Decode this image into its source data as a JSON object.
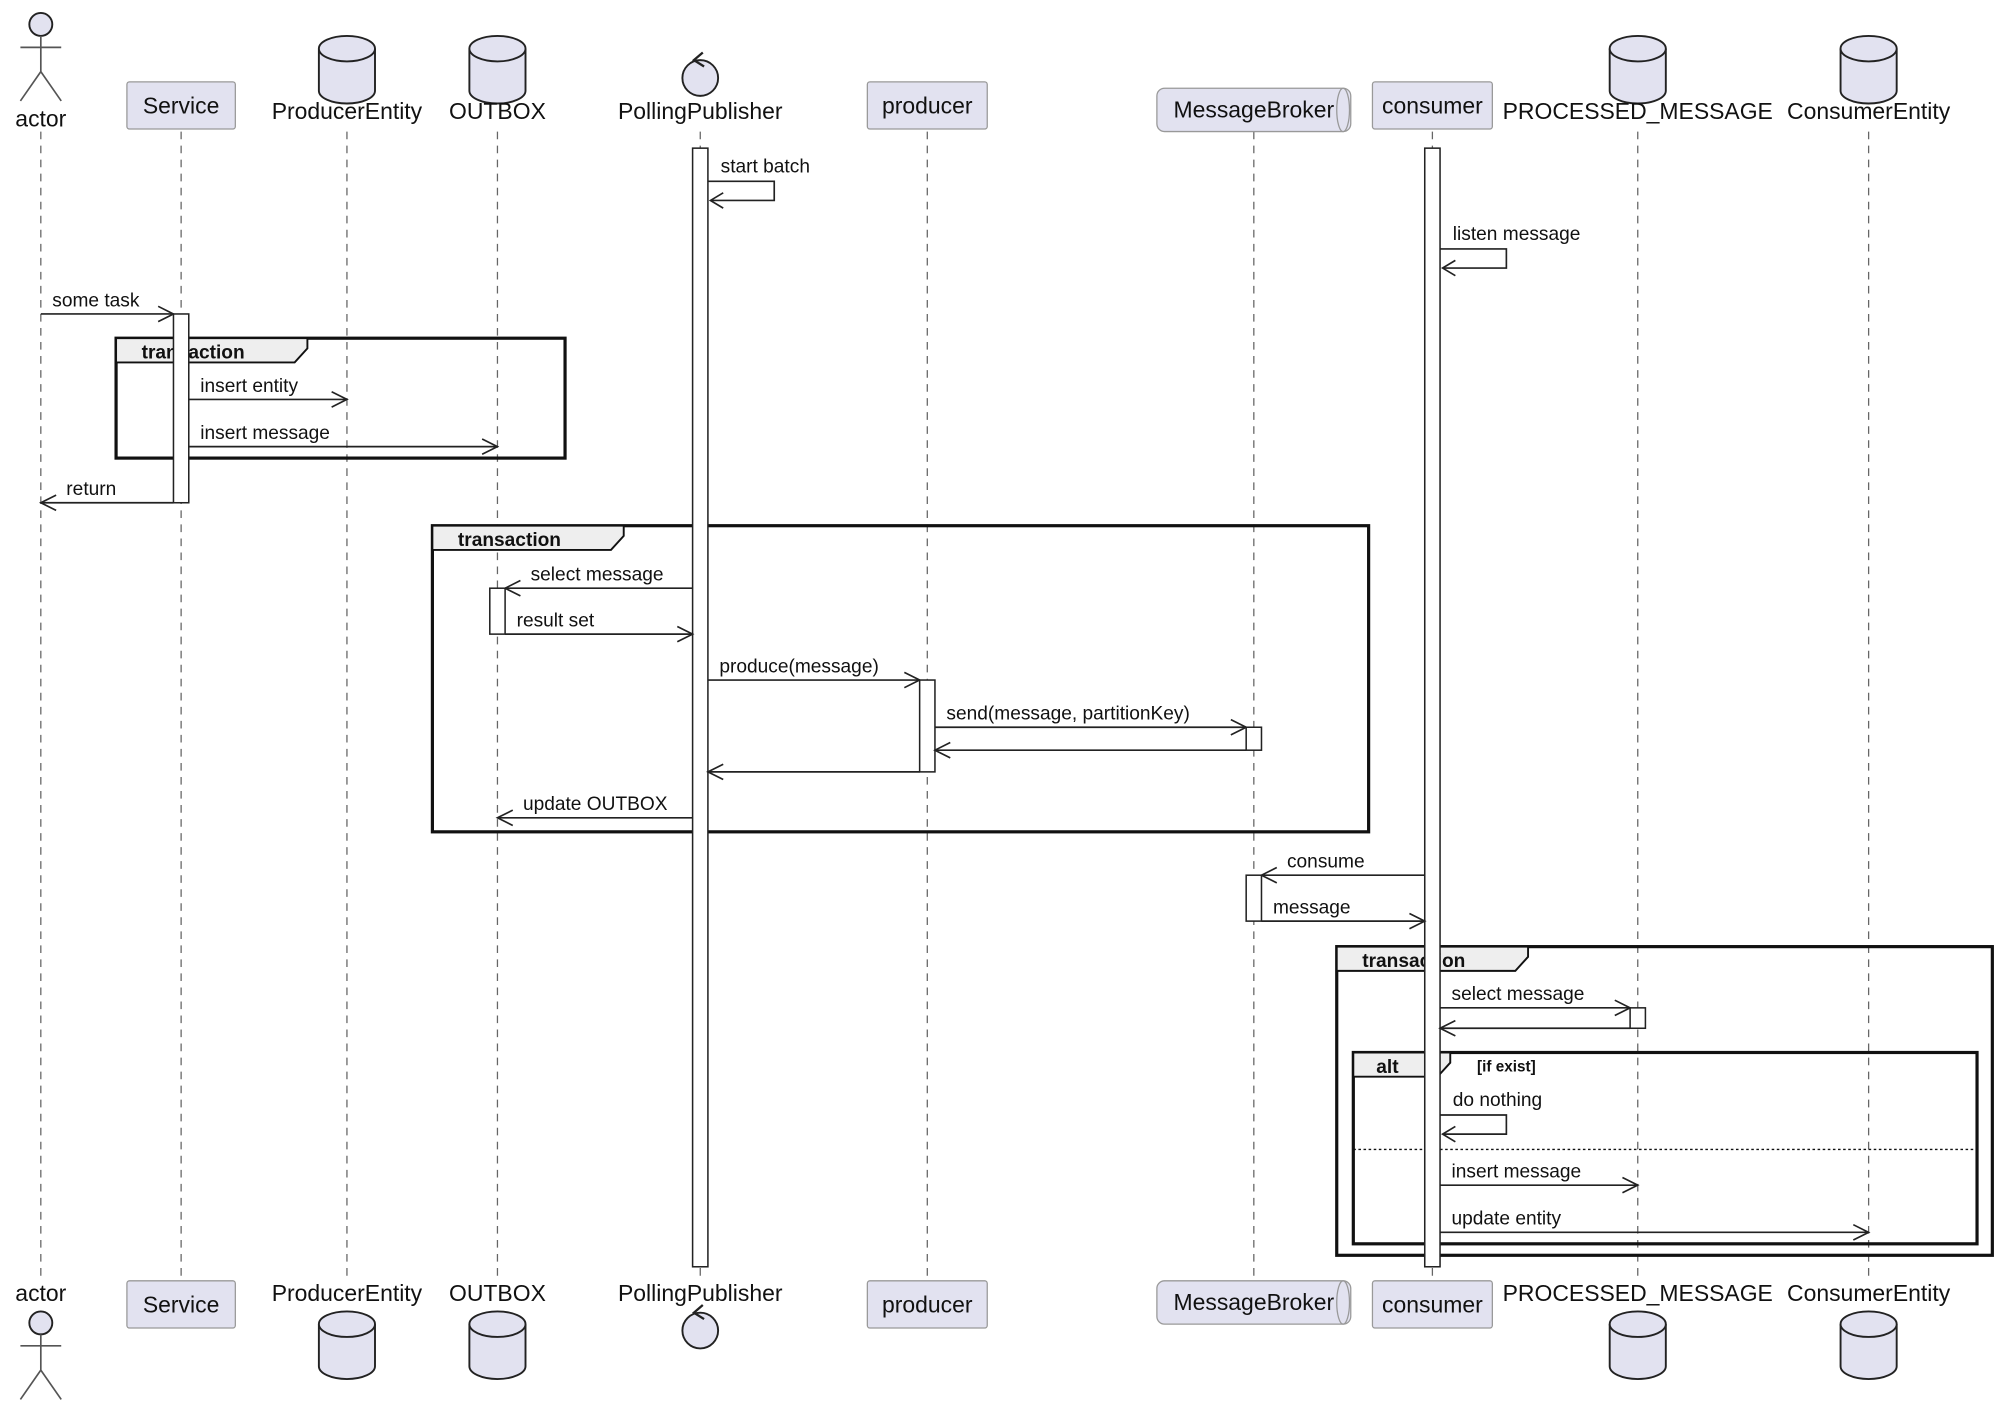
{
  "participants": [
    {
      "id": "actor",
      "label": "actor",
      "kind": "actor"
    },
    {
      "id": "service",
      "label": "Service",
      "kind": "participant"
    },
    {
      "id": "producer_entity",
      "label": "ProducerEntity",
      "kind": "database"
    },
    {
      "id": "outbox",
      "label": "OUTBOX",
      "kind": "database"
    },
    {
      "id": "polling_publisher",
      "label": "PollingPublisher",
      "kind": "control"
    },
    {
      "id": "producer",
      "label": "producer",
      "kind": "participant"
    },
    {
      "id": "message_broker",
      "label": "MessageBroker",
      "kind": "queue"
    },
    {
      "id": "consumer",
      "label": "consumer",
      "kind": "participant"
    },
    {
      "id": "processed_message",
      "label": "PROCESSED_MESSAGE",
      "kind": "database"
    },
    {
      "id": "consumer_entity",
      "label": "ConsumerEntity",
      "kind": "database"
    }
  ],
  "messages": [
    {
      "from": "polling_publisher",
      "to": "polling_publisher",
      "label": "start batch"
    },
    {
      "from": "consumer",
      "to": "consumer",
      "label": "listen message"
    },
    {
      "from": "actor",
      "to": "service",
      "label": "some task"
    },
    {
      "from": "service",
      "to": "producer_entity",
      "label": "insert entity"
    },
    {
      "from": "service",
      "to": "outbox",
      "label": "insert message"
    },
    {
      "from": "service",
      "to": "actor",
      "label": "return"
    },
    {
      "from": "polling_publisher",
      "to": "outbox",
      "label": "select message"
    },
    {
      "from": "outbox",
      "to": "polling_publisher",
      "label": "result set"
    },
    {
      "from": "polling_publisher",
      "to": "producer",
      "label": "produce(message)"
    },
    {
      "from": "producer",
      "to": "message_broker",
      "label": "send(message, partitionKey)"
    },
    {
      "from": "message_broker",
      "to": "producer",
      "label": ""
    },
    {
      "from": "producer",
      "to": "polling_publisher",
      "label": ""
    },
    {
      "from": "polling_publisher",
      "to": "outbox",
      "label": "update OUTBOX"
    },
    {
      "from": "consumer",
      "to": "message_broker",
      "label": "consume"
    },
    {
      "from": "message_broker",
      "to": "consumer",
      "label": "message"
    },
    {
      "from": "consumer",
      "to": "processed_message",
      "label": "select message"
    },
    {
      "from": "processed_message",
      "to": "consumer",
      "label": ""
    },
    {
      "from": "consumer",
      "to": "consumer",
      "label": "do nothing"
    },
    {
      "from": "consumer",
      "to": "processed_message",
      "label": "insert message"
    },
    {
      "from": "consumer",
      "to": "consumer_entity",
      "label": "update entity"
    }
  ],
  "fragments": [
    {
      "type": "group",
      "label": "transaction",
      "guard": ""
    },
    {
      "type": "group",
      "label": "transaction",
      "guard": ""
    },
    {
      "type": "group",
      "label": "transaction",
      "guard": ""
    },
    {
      "type": "alt",
      "label": "alt",
      "guard": "[if exist]"
    }
  ],
  "colors": {
    "participant_fill": "#e2e2f0",
    "frame_tab": "#eeeeee",
    "line": "#222222"
  }
}
